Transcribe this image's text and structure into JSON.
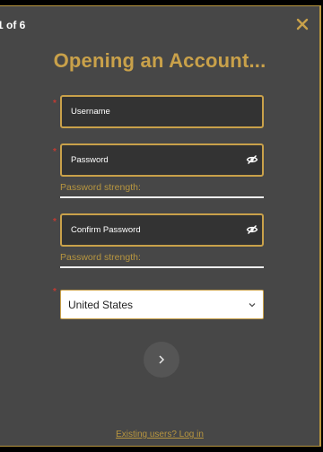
{
  "header": {
    "step": "1 of 6",
    "title": "Opening an Account..."
  },
  "form": {
    "username": {
      "placeholder": "Username",
      "value": ""
    },
    "password": {
      "placeholder": "Password",
      "value": "",
      "strength_label": "Password strength:"
    },
    "confirm_password": {
      "placeholder": "Confirm Password",
      "value": "",
      "strength_label": "Password strength:"
    },
    "country": {
      "selected": "United States"
    }
  },
  "footer": {
    "existing_users_link": "Existing users? Log in"
  },
  "icons": {
    "close": "close-icon",
    "eye": "eye-slash-icon",
    "chevron": "chevron-down-icon",
    "next": "chevron-right-icon"
  },
  "colors": {
    "accent": "#c9a14a",
    "panel_bg": "#474747",
    "field_bg": "#333333",
    "required": "#c23a32"
  }
}
